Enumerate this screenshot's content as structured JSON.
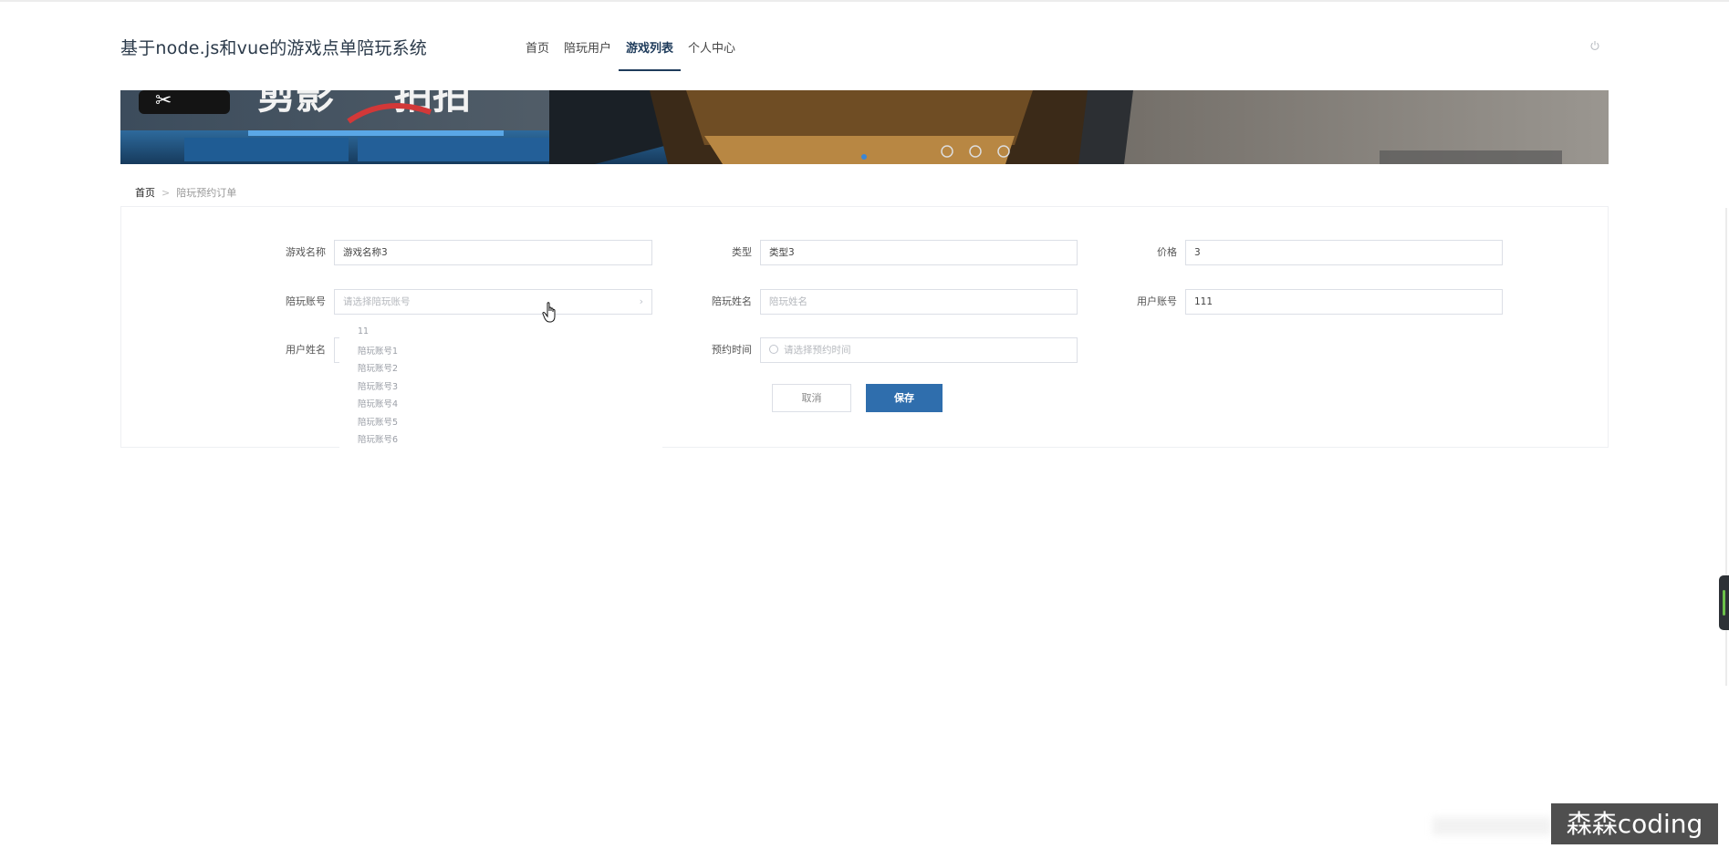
{
  "header": {
    "site_title": "基于node.js和vue的游戏点单陪玩系统",
    "nav": [
      "首页",
      "陪玩用户",
      "游戏列表",
      "个人中心"
    ],
    "active_nav": "游戏列表",
    "power_icon": "power-icon"
  },
  "breadcrumb": {
    "home": "首页",
    "separator": ">",
    "current": "陪玩预约订单"
  },
  "form": {
    "game_name": {
      "label": "游戏名称",
      "value": "游戏名称3"
    },
    "type": {
      "label": "类型",
      "value": "类型3"
    },
    "price": {
      "label": "价格",
      "value": "3"
    },
    "companion_account": {
      "label": "陪玩账号",
      "placeholder": "请选择陪玩账号"
    },
    "companion_name": {
      "label": "陪玩姓名",
      "placeholder": "陪玩姓名"
    },
    "user_account": {
      "label": "用户账号",
      "value": "111"
    },
    "user_name": {
      "label": "用户姓名"
    },
    "booking_time": {
      "label": "预约时间",
      "placeholder": "请选择预约时间"
    },
    "cancel_label": "取消",
    "save_label": "保存"
  },
  "dropdown_options": [
    "11",
    "陪玩账号1",
    "陪玩账号2",
    "陪玩账号3",
    "陪玩账号4",
    "陪玩账号5",
    "陪玩账号6"
  ],
  "watermark": "森森coding",
  "colors": {
    "accent": "#2f6ead",
    "nav_active": "#1e3b5b"
  }
}
